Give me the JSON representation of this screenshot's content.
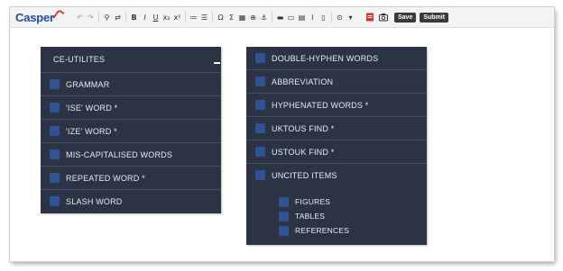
{
  "app": {
    "logo_text": "Casper"
  },
  "toolbar": {
    "tools": [
      {
        "icon": "undo-icon",
        "glyph": "↶",
        "dim": true
      },
      {
        "icon": "redo-icon",
        "glyph": "↷",
        "dim": true
      },
      {
        "icon": "find-icon",
        "glyph": "⚲"
      },
      {
        "icon": "replace-icon",
        "glyph": "⇄"
      },
      {
        "icon": "bold-icon",
        "glyph": "B"
      },
      {
        "icon": "italic-icon",
        "glyph": "I"
      },
      {
        "icon": "underline-icon",
        "glyph": "U"
      },
      {
        "icon": "subscript-icon",
        "glyph": "x₂"
      },
      {
        "icon": "superscript-icon",
        "glyph": "x²"
      },
      {
        "icon": "numbered-list-icon",
        "glyph": "≔"
      },
      {
        "icon": "bullet-list-icon",
        "glyph": "☰"
      },
      {
        "icon": "special-character-icon",
        "glyph": "Ω"
      },
      {
        "icon": "sigma-icon",
        "glyph": "Σ"
      },
      {
        "icon": "table-icon",
        "glyph": "▦"
      },
      {
        "icon": "link-icon",
        "glyph": "⊕"
      },
      {
        "icon": "anchor-icon",
        "glyph": "⚓"
      },
      {
        "icon": "comment-icon",
        "glyph": "▬"
      },
      {
        "icon": "image-icon",
        "glyph": "▭"
      },
      {
        "icon": "clipboard-icon",
        "glyph": "▤"
      },
      {
        "icon": "attachment-icon",
        "glyph": "⌇"
      },
      {
        "icon": "document-icon",
        "glyph": "▯"
      },
      {
        "icon": "add-icon",
        "glyph": "⊙"
      },
      {
        "icon": "dropdown-icon",
        "glyph": "▾"
      }
    ],
    "actions": {
      "pdf_icon": "pdf-icon",
      "camera_icon": "camera-icon",
      "save_label": "Save",
      "submit_label": "Submit"
    }
  },
  "left_panel": {
    "title": "CE-UTILITES",
    "items": [
      {
        "label": "GRAMMAR"
      },
      {
        "label": "'ISE' WORD *"
      },
      {
        "label": "'IZE' WORD *"
      },
      {
        "label": "MIS-CAPITALISED WORDS"
      },
      {
        "label": "REPEATED WORD *"
      },
      {
        "label": "SLASH WORD"
      }
    ]
  },
  "right_panel": {
    "items": [
      {
        "label": "DOUBLE-HYPHEN WORDS"
      },
      {
        "label": "ABBREVIATION"
      },
      {
        "label": "HYPHENATED WORDS *"
      },
      {
        "label": "UKTOUS FIND *"
      },
      {
        "label": "USTOUK FIND *"
      },
      {
        "label": "UNCITED ITEMS"
      }
    ],
    "subitems": [
      {
        "label": "FIGURES"
      },
      {
        "label": "TABLES"
      },
      {
        "label": "REFERENCES"
      }
    ]
  },
  "colors": {
    "panel_bg": "#2b3344",
    "checkbox": "#2f5395",
    "logo": "#1f4e9e",
    "logo_accent": "#d63a2f",
    "button_bg": "#3a3a3a"
  }
}
